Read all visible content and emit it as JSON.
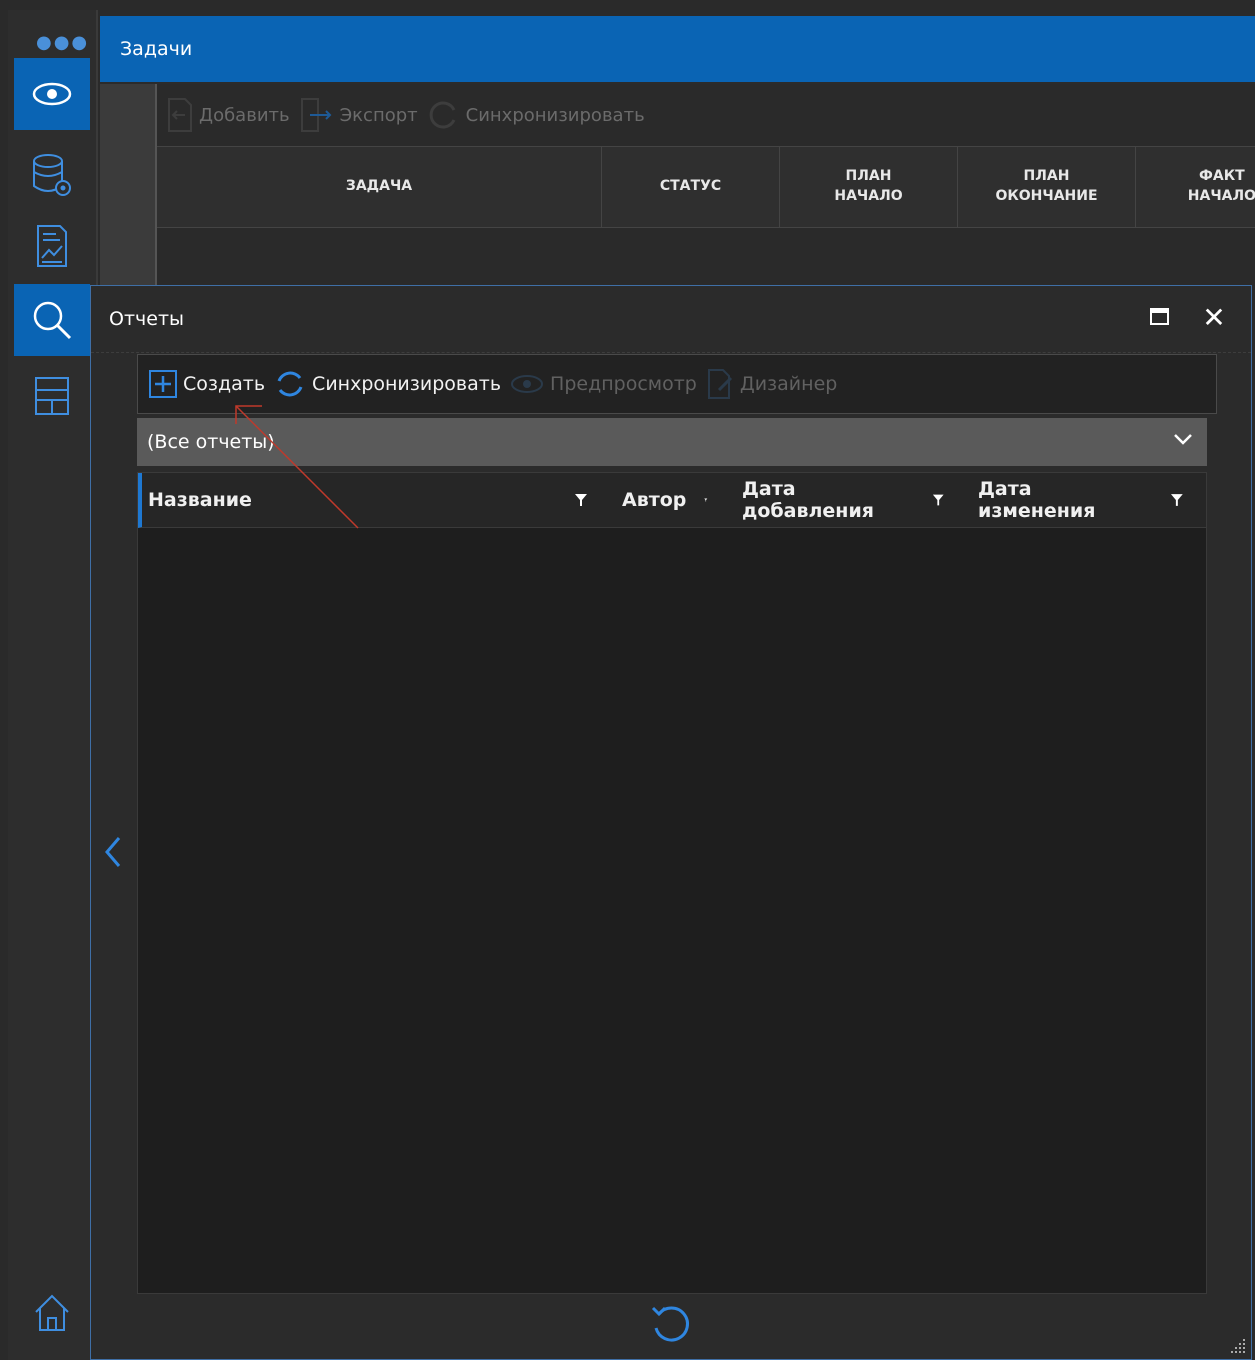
{
  "rail": {
    "items": [
      {
        "name": "more",
        "icon": "dots-icon"
      },
      {
        "name": "view",
        "icon": "eye-icon",
        "active": true
      },
      {
        "name": "database-settings",
        "icon": "database-gear-icon"
      },
      {
        "name": "report-chart",
        "icon": "report-chart-icon"
      },
      {
        "name": "search",
        "icon": "search-icon",
        "active": true
      },
      {
        "name": "layout",
        "icon": "layout-icon"
      },
      {
        "name": "home",
        "icon": "home-icon"
      }
    ]
  },
  "tasks": {
    "title": "Задачи",
    "toolbar": {
      "add_label": "Добавить",
      "export_label": "Экспорт",
      "sync_label": "Синхронизировать"
    },
    "columns": [
      {
        "label": "ЗАДАЧА"
      },
      {
        "label": "СТАТУС"
      },
      {
        "label": "ПЛАН\nНАЧАЛО"
      },
      {
        "label": "ПЛАН\nОКОНЧАНИЕ"
      },
      {
        "label": "ФАКТ\nНАЧАЛО"
      }
    ]
  },
  "reports": {
    "title": "Отчеты",
    "toolbar": {
      "create_label": "Создать",
      "sync_label": "Синхронизировать",
      "preview_label": "Предпросмотр",
      "designer_label": "Дизайнер"
    },
    "filter": {
      "selected": "(Все отчеты)"
    },
    "grid": {
      "columns": [
        "Название",
        "Автор",
        "Дата добавления",
        "Дата изменения"
      ],
      "rows": []
    }
  },
  "colors": {
    "accent": "#0a64b4",
    "annotation": "#c0392b"
  }
}
